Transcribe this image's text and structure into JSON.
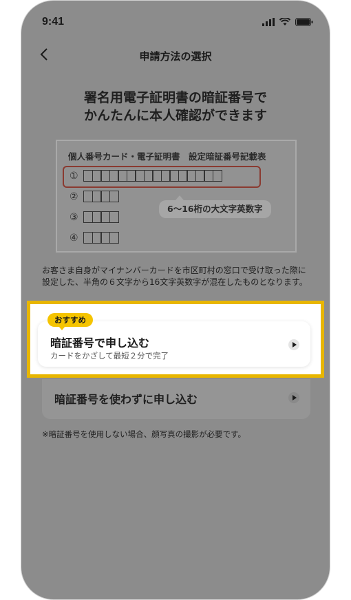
{
  "status_bar": {
    "time": "9:41"
  },
  "nav": {
    "title": "申請方法の選択"
  },
  "headline": {
    "line1": "署名用電子証明書の暗証番号で",
    "line2": "かんたんに本人確認ができます"
  },
  "card_figure": {
    "caption": "個人番号カード・電子証明書　設定暗証番号記載表",
    "rows": [
      "①",
      "②",
      "③",
      "④"
    ],
    "bubble": "6〜16桁の大文字英数字"
  },
  "description": "お客さま自身がマイナンバーカードを市区町村の窓口で受け取った際に設定した、半角の６文字から16文字英数字が混在したものとなります。",
  "recommended": {
    "badge": "おすすめ",
    "title": "暗証番号で申し込む",
    "subtitle": "カードをかざして最短２分で完了"
  },
  "alternative": {
    "title": "暗証番号を使わずに申し込む"
  },
  "note": "※暗証番号を使用しない場合、顔写真の撮影が必要です。"
}
